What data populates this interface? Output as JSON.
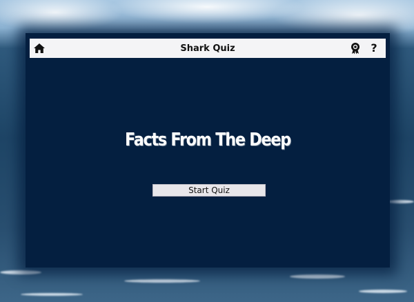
{
  "header": {
    "title": "Shark Quiz",
    "home_icon": "home-icon",
    "award_icon": "award-icon",
    "help_label": "?"
  },
  "main": {
    "headline": "Facts From The Deep",
    "start_button_label": "Start Quiz"
  },
  "colors": {
    "panel": "#041f40",
    "header": "#f4f4f6",
    "button": "#e8e6ea"
  }
}
